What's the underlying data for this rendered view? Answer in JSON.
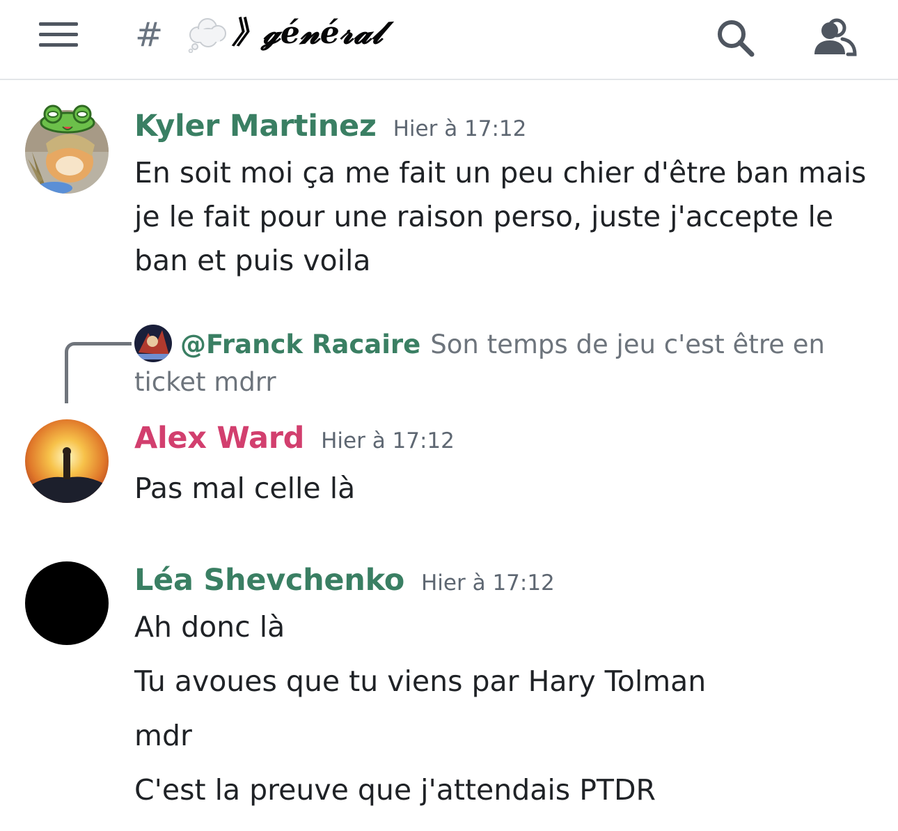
{
  "header": {
    "menu_icon": "hamburger-menu-icon",
    "hash": "#",
    "channel_emoji": "thought-bubble-emoji",
    "channel_name": "》𝓰é𝓷é𝓻𝓪𝓵",
    "search_icon": "search-icon",
    "members_icon": "members-icon"
  },
  "messages": [
    {
      "author": "Kyler Martinez",
      "author_color": "#3a7f63",
      "timestamp": "Hier à 17:12",
      "text": "En soit moi ça me fait un peu chier d'être ban mais je le fait pour une raison perso, juste j'accepte le ban et puis voila"
    },
    {
      "reply": {
        "author": "@Franck Racaire",
        "text": "Son temps de jeu c'est être en ticket mdrr"
      },
      "author": "Alex Ward",
      "author_color": "#d23f6e",
      "timestamp": "Hier à 17:12",
      "text": "Pas mal celle là"
    },
    {
      "author": "Léa Shevchenko",
      "author_color": "#3a7f63",
      "timestamp": "Hier à 17:12",
      "lines": [
        "Ah donc là",
        "Tu avoues que tu viens par Hary Tolman",
        "mdr",
        "C'est la preuve que j'attendais PTDR"
      ]
    }
  ]
}
